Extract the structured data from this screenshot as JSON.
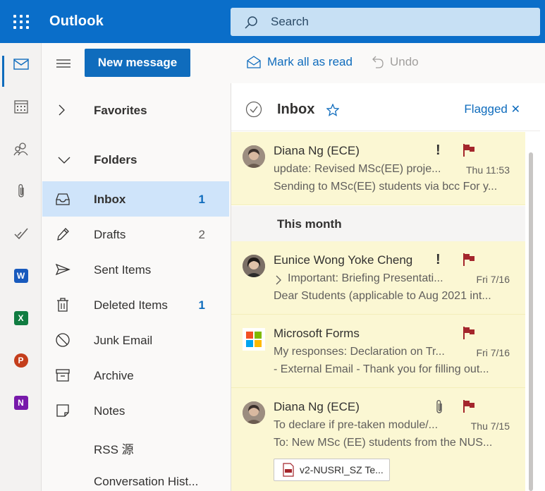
{
  "app": {
    "title": "Outlook"
  },
  "search": {
    "placeholder": "Search"
  },
  "toolbar": {
    "new_message": "New message",
    "mark_all_read": "Mark all as read",
    "undo": "Undo"
  },
  "folders": {
    "favorites": "Favorites",
    "folders_header": "Folders",
    "items": [
      {
        "name": "Inbox",
        "count": "1",
        "icon": "inbox-icon"
      },
      {
        "name": "Drafts",
        "count": "2",
        "icon": "pencil-icon"
      },
      {
        "name": "Sent Items",
        "count": "",
        "icon": "send-icon"
      },
      {
        "name": "Deleted Items",
        "count": "1",
        "icon": "trash-icon"
      },
      {
        "name": "Junk Email",
        "count": "",
        "icon": "block-icon"
      },
      {
        "name": "Archive",
        "count": "",
        "icon": "archive-icon"
      },
      {
        "name": "Notes",
        "count": "",
        "icon": "note-icon"
      },
      {
        "name": "RSS 源",
        "count": "",
        "icon": ""
      },
      {
        "name": "Conversation Hist...",
        "count": "",
        "icon": ""
      }
    ]
  },
  "list": {
    "title": "Inbox",
    "filter": "Flagged",
    "group_label": "This month",
    "messages": [
      {
        "sender": "Diana Ng (ECE)",
        "subject": "update: Revised MSc(EE) proje...",
        "time": "Thu 11:53",
        "preview": "Sending to MSc(EE) students via bcc For y...",
        "important": "!"
      },
      {
        "sender": "Eunice Wong Yoke Cheng",
        "subject": "Important: Briefing Presentati...",
        "time": "Fri 7/16",
        "preview": "Dear Students (applicable to Aug 2021 int...",
        "important": "!"
      },
      {
        "sender": "Microsoft Forms",
        "subject": "My responses: Declaration on Tr...",
        "time": "Fri 7/16",
        "preview": "- External Email - Thank you for filling out..."
      },
      {
        "sender": "Diana Ng (ECE)",
        "subject": "To declare if pre-taken module/...",
        "time": "Thu 7/15",
        "preview": "To: New MSc (EE) students from the NUS...",
        "attachment": "v2-NUSRI_SZ Te..."
      }
    ]
  },
  "colors": {
    "brand": "#0f6cbd",
    "flag": "#a4262c",
    "unread_bg": "#fbf7d3",
    "selected_folder": "#cfe4fa"
  }
}
